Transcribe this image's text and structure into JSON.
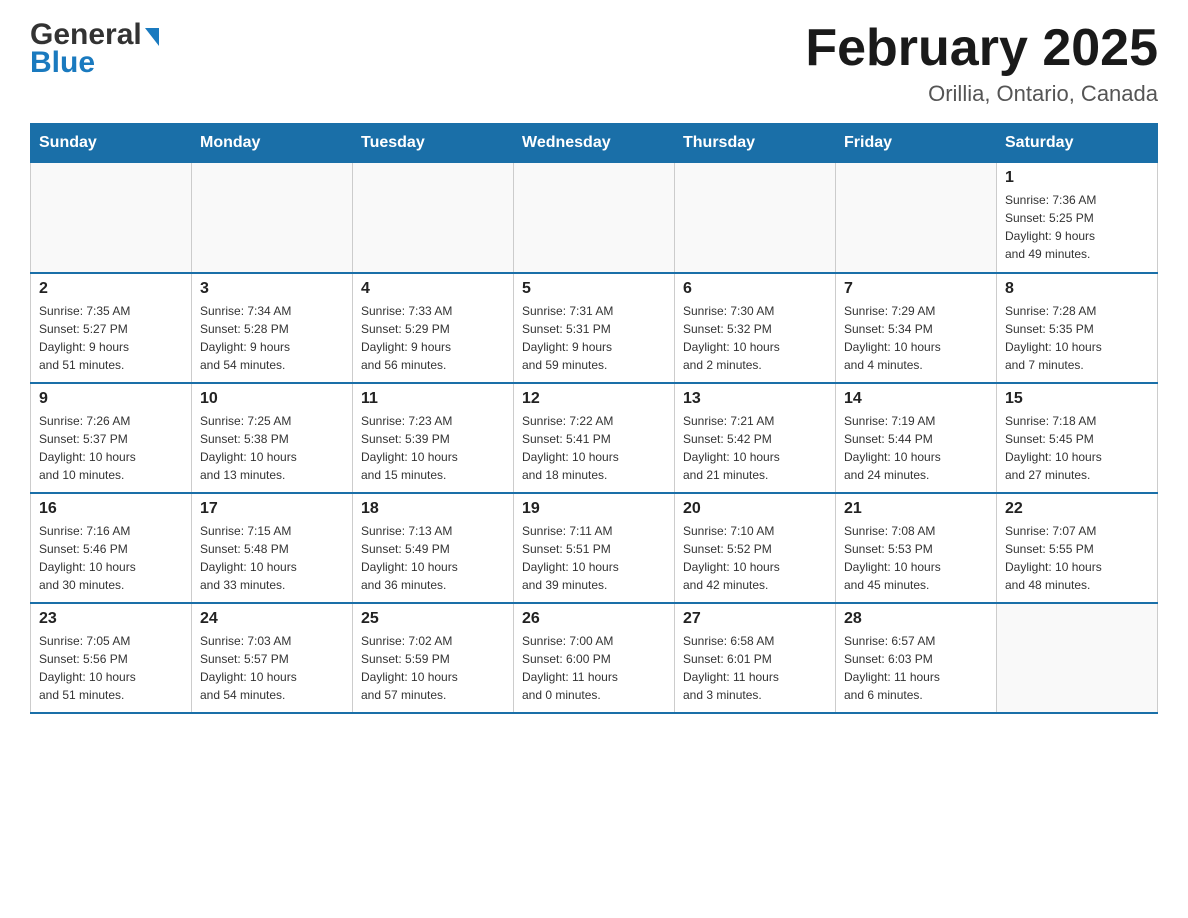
{
  "header": {
    "logo_text_general": "General",
    "logo_text_blue": "Blue",
    "month_year": "February 2025",
    "location": "Orillia, Ontario, Canada"
  },
  "weekdays": [
    "Sunday",
    "Monday",
    "Tuesday",
    "Wednesday",
    "Thursday",
    "Friday",
    "Saturday"
  ],
  "weeks": [
    [
      {
        "day": "",
        "info": ""
      },
      {
        "day": "",
        "info": ""
      },
      {
        "day": "",
        "info": ""
      },
      {
        "day": "",
        "info": ""
      },
      {
        "day": "",
        "info": ""
      },
      {
        "day": "",
        "info": ""
      },
      {
        "day": "1",
        "info": "Sunrise: 7:36 AM\nSunset: 5:25 PM\nDaylight: 9 hours\nand 49 minutes."
      }
    ],
    [
      {
        "day": "2",
        "info": "Sunrise: 7:35 AM\nSunset: 5:27 PM\nDaylight: 9 hours\nand 51 minutes."
      },
      {
        "day": "3",
        "info": "Sunrise: 7:34 AM\nSunset: 5:28 PM\nDaylight: 9 hours\nand 54 minutes."
      },
      {
        "day": "4",
        "info": "Sunrise: 7:33 AM\nSunset: 5:29 PM\nDaylight: 9 hours\nand 56 minutes."
      },
      {
        "day": "5",
        "info": "Sunrise: 7:31 AM\nSunset: 5:31 PM\nDaylight: 9 hours\nand 59 minutes."
      },
      {
        "day": "6",
        "info": "Sunrise: 7:30 AM\nSunset: 5:32 PM\nDaylight: 10 hours\nand 2 minutes."
      },
      {
        "day": "7",
        "info": "Sunrise: 7:29 AM\nSunset: 5:34 PM\nDaylight: 10 hours\nand 4 minutes."
      },
      {
        "day": "8",
        "info": "Sunrise: 7:28 AM\nSunset: 5:35 PM\nDaylight: 10 hours\nand 7 minutes."
      }
    ],
    [
      {
        "day": "9",
        "info": "Sunrise: 7:26 AM\nSunset: 5:37 PM\nDaylight: 10 hours\nand 10 minutes."
      },
      {
        "day": "10",
        "info": "Sunrise: 7:25 AM\nSunset: 5:38 PM\nDaylight: 10 hours\nand 13 minutes."
      },
      {
        "day": "11",
        "info": "Sunrise: 7:23 AM\nSunset: 5:39 PM\nDaylight: 10 hours\nand 15 minutes."
      },
      {
        "day": "12",
        "info": "Sunrise: 7:22 AM\nSunset: 5:41 PM\nDaylight: 10 hours\nand 18 minutes."
      },
      {
        "day": "13",
        "info": "Sunrise: 7:21 AM\nSunset: 5:42 PM\nDaylight: 10 hours\nand 21 minutes."
      },
      {
        "day": "14",
        "info": "Sunrise: 7:19 AM\nSunset: 5:44 PM\nDaylight: 10 hours\nand 24 minutes."
      },
      {
        "day": "15",
        "info": "Sunrise: 7:18 AM\nSunset: 5:45 PM\nDaylight: 10 hours\nand 27 minutes."
      }
    ],
    [
      {
        "day": "16",
        "info": "Sunrise: 7:16 AM\nSunset: 5:46 PM\nDaylight: 10 hours\nand 30 minutes."
      },
      {
        "day": "17",
        "info": "Sunrise: 7:15 AM\nSunset: 5:48 PM\nDaylight: 10 hours\nand 33 minutes."
      },
      {
        "day": "18",
        "info": "Sunrise: 7:13 AM\nSunset: 5:49 PM\nDaylight: 10 hours\nand 36 minutes."
      },
      {
        "day": "19",
        "info": "Sunrise: 7:11 AM\nSunset: 5:51 PM\nDaylight: 10 hours\nand 39 minutes."
      },
      {
        "day": "20",
        "info": "Sunrise: 7:10 AM\nSunset: 5:52 PM\nDaylight: 10 hours\nand 42 minutes."
      },
      {
        "day": "21",
        "info": "Sunrise: 7:08 AM\nSunset: 5:53 PM\nDaylight: 10 hours\nand 45 minutes."
      },
      {
        "day": "22",
        "info": "Sunrise: 7:07 AM\nSunset: 5:55 PM\nDaylight: 10 hours\nand 48 minutes."
      }
    ],
    [
      {
        "day": "23",
        "info": "Sunrise: 7:05 AM\nSunset: 5:56 PM\nDaylight: 10 hours\nand 51 minutes."
      },
      {
        "day": "24",
        "info": "Sunrise: 7:03 AM\nSunset: 5:57 PM\nDaylight: 10 hours\nand 54 minutes."
      },
      {
        "day": "25",
        "info": "Sunrise: 7:02 AM\nSunset: 5:59 PM\nDaylight: 10 hours\nand 57 minutes."
      },
      {
        "day": "26",
        "info": "Sunrise: 7:00 AM\nSunset: 6:00 PM\nDaylight: 11 hours\nand 0 minutes."
      },
      {
        "day": "27",
        "info": "Sunrise: 6:58 AM\nSunset: 6:01 PM\nDaylight: 11 hours\nand 3 minutes."
      },
      {
        "day": "28",
        "info": "Sunrise: 6:57 AM\nSunset: 6:03 PM\nDaylight: 11 hours\nand 6 minutes."
      },
      {
        "day": "",
        "info": ""
      }
    ]
  ]
}
